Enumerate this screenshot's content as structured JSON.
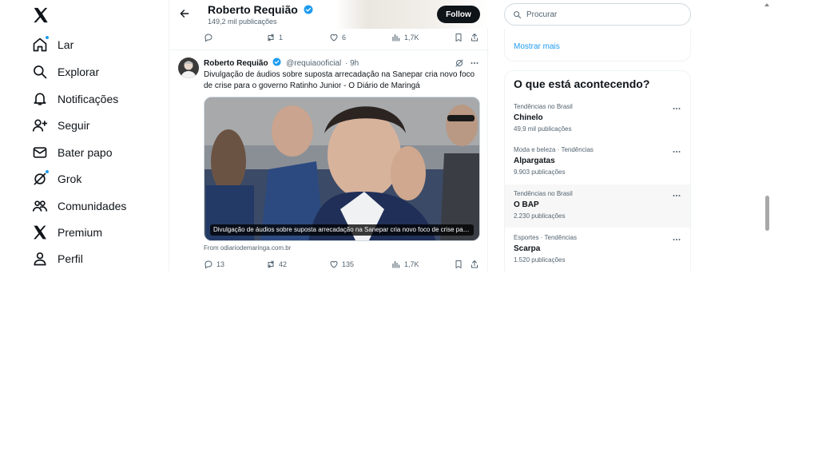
{
  "sidebar": {
    "logo": "x-logo-icon",
    "items": [
      {
        "label": "Lar",
        "icon": "home-icon",
        "badge": true
      },
      {
        "label": "Explorar",
        "icon": "search-icon"
      },
      {
        "label": "Notificações",
        "icon": "bell-icon"
      },
      {
        "label": "Seguir",
        "icon": "add-person-icon"
      },
      {
        "label": "Bater papo",
        "icon": "envelope-icon"
      },
      {
        "label": "Grok",
        "icon": "grok-icon",
        "badge": true
      },
      {
        "label": "Comunidades",
        "icon": "people-icon"
      },
      {
        "label": "Premium",
        "icon": "x-icon"
      },
      {
        "label": "Perfil",
        "icon": "person-icon"
      }
    ]
  },
  "header": {
    "name": "Roberto Requião",
    "posts_count": "149,2 mil publicações",
    "follow_label": "Follow"
  },
  "prev_tweet": {
    "replies": "",
    "retweets": "1",
    "likes": "6",
    "views": "1,7K"
  },
  "tweet": {
    "author": "Roberto Requião",
    "handle": "@requiaooficial",
    "time": "· 9h",
    "text": "Divulgação de áudios sobre suposta arrecadação na Sanepar cria novo foco de crise para o governo Ratinho Junior - O Diário de Maringá",
    "card_caption": "Divulgação de áudios sobre suposta arrecadação na Sanepar cria novo foco de crise para o governo Ratinho Junior",
    "source": "From odiariodemaringa.com.br",
    "replies": "13",
    "retweets": "42",
    "likes": "135",
    "views": "1,7K"
  },
  "search": {
    "placeholder": "Procurar"
  },
  "right": {
    "show_more": "Mostrar mais",
    "trends_title": "O que está acontecendo?",
    "trends": [
      {
        "context": "Tendências no Brasil",
        "title": "Chinelo",
        "count": "49,9 mil publicações"
      },
      {
        "context": "Moda e beleza · Tendências",
        "title": "Alpargatas",
        "count": "9.903 publicações"
      },
      {
        "context": "Tendências no Brasil",
        "title": "O BAP",
        "count": "2.230 publicações"
      },
      {
        "context": "Esportes · Tendências",
        "title": "Scarpa",
        "count": "1.520 publicações"
      }
    ]
  },
  "colors": {
    "accent": "#1d9bf0",
    "text": "#0f1419",
    "muted": "#536471",
    "border": "#eff3f4"
  }
}
